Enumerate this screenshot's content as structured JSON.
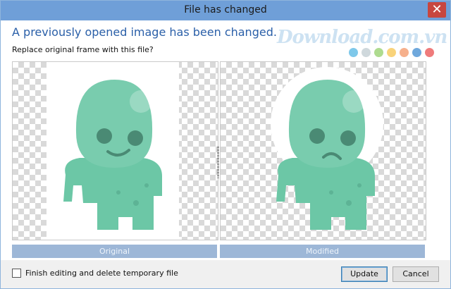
{
  "window": {
    "title": "File has changed",
    "close_glyph": "✕"
  },
  "dialog": {
    "headline": "A previously opened image has been changed.",
    "prompt": "Replace original frame with this file?"
  },
  "watermark": {
    "text": "Download.com.vn",
    "dot_colors": [
      "#7ec8ea",
      "#cfd8dc",
      "#aedb8f",
      "#f9d37a",
      "#f6b08c",
      "#6fa8dc",
      "#ef7b7b"
    ]
  },
  "panels": {
    "original": {
      "label": "Original",
      "expression": "smile"
    },
    "modified": {
      "label": "Modified",
      "expression": "frown"
    }
  },
  "footer": {
    "checkbox_label": "Finish editing and delete temporary file",
    "checkbox_checked": false,
    "update_label": "Update",
    "cancel_label": "Cancel"
  },
  "colors": {
    "character_body": "#6cc7a6",
    "character_head": "#79ccae",
    "character_eye": "#4a8a74",
    "titlebar": "#6f9fd8",
    "label_bar": "#9db7d7"
  }
}
